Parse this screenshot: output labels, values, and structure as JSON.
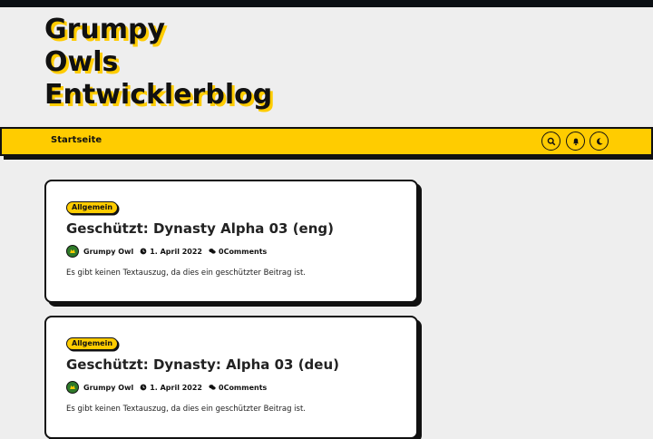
{
  "site": {
    "title_lines": [
      "Grumpy",
      "Owls",
      "Entwicklerblog"
    ]
  },
  "nav": {
    "home_label": "Startseite",
    "icons": [
      "search-icon",
      "bell-icon",
      "moon-icon"
    ]
  },
  "posts": [
    {
      "category": "Allgemein",
      "title": "Geschützt: Dynasty Alpha 03 (eng)",
      "author": "Grumpy Owl",
      "date": "1. April 2022",
      "comments": "0Comments",
      "excerpt": "Es gibt keinen Textauszug, da dies ein geschützter Beitrag ist."
    },
    {
      "category": "Allgemein",
      "title": "Geschützt: Dynasty: Alpha 03 (deu)",
      "author": "Grumpy Owl",
      "date": "1. April 2022",
      "comments": "0Comments",
      "excerpt": "Es gibt keinen Textauszug, da dies ein geschützter Beitrag ist."
    }
  ],
  "colors": {
    "accent": "#ffcc00",
    "dark": "#111111",
    "background": "#eeeeee"
  }
}
